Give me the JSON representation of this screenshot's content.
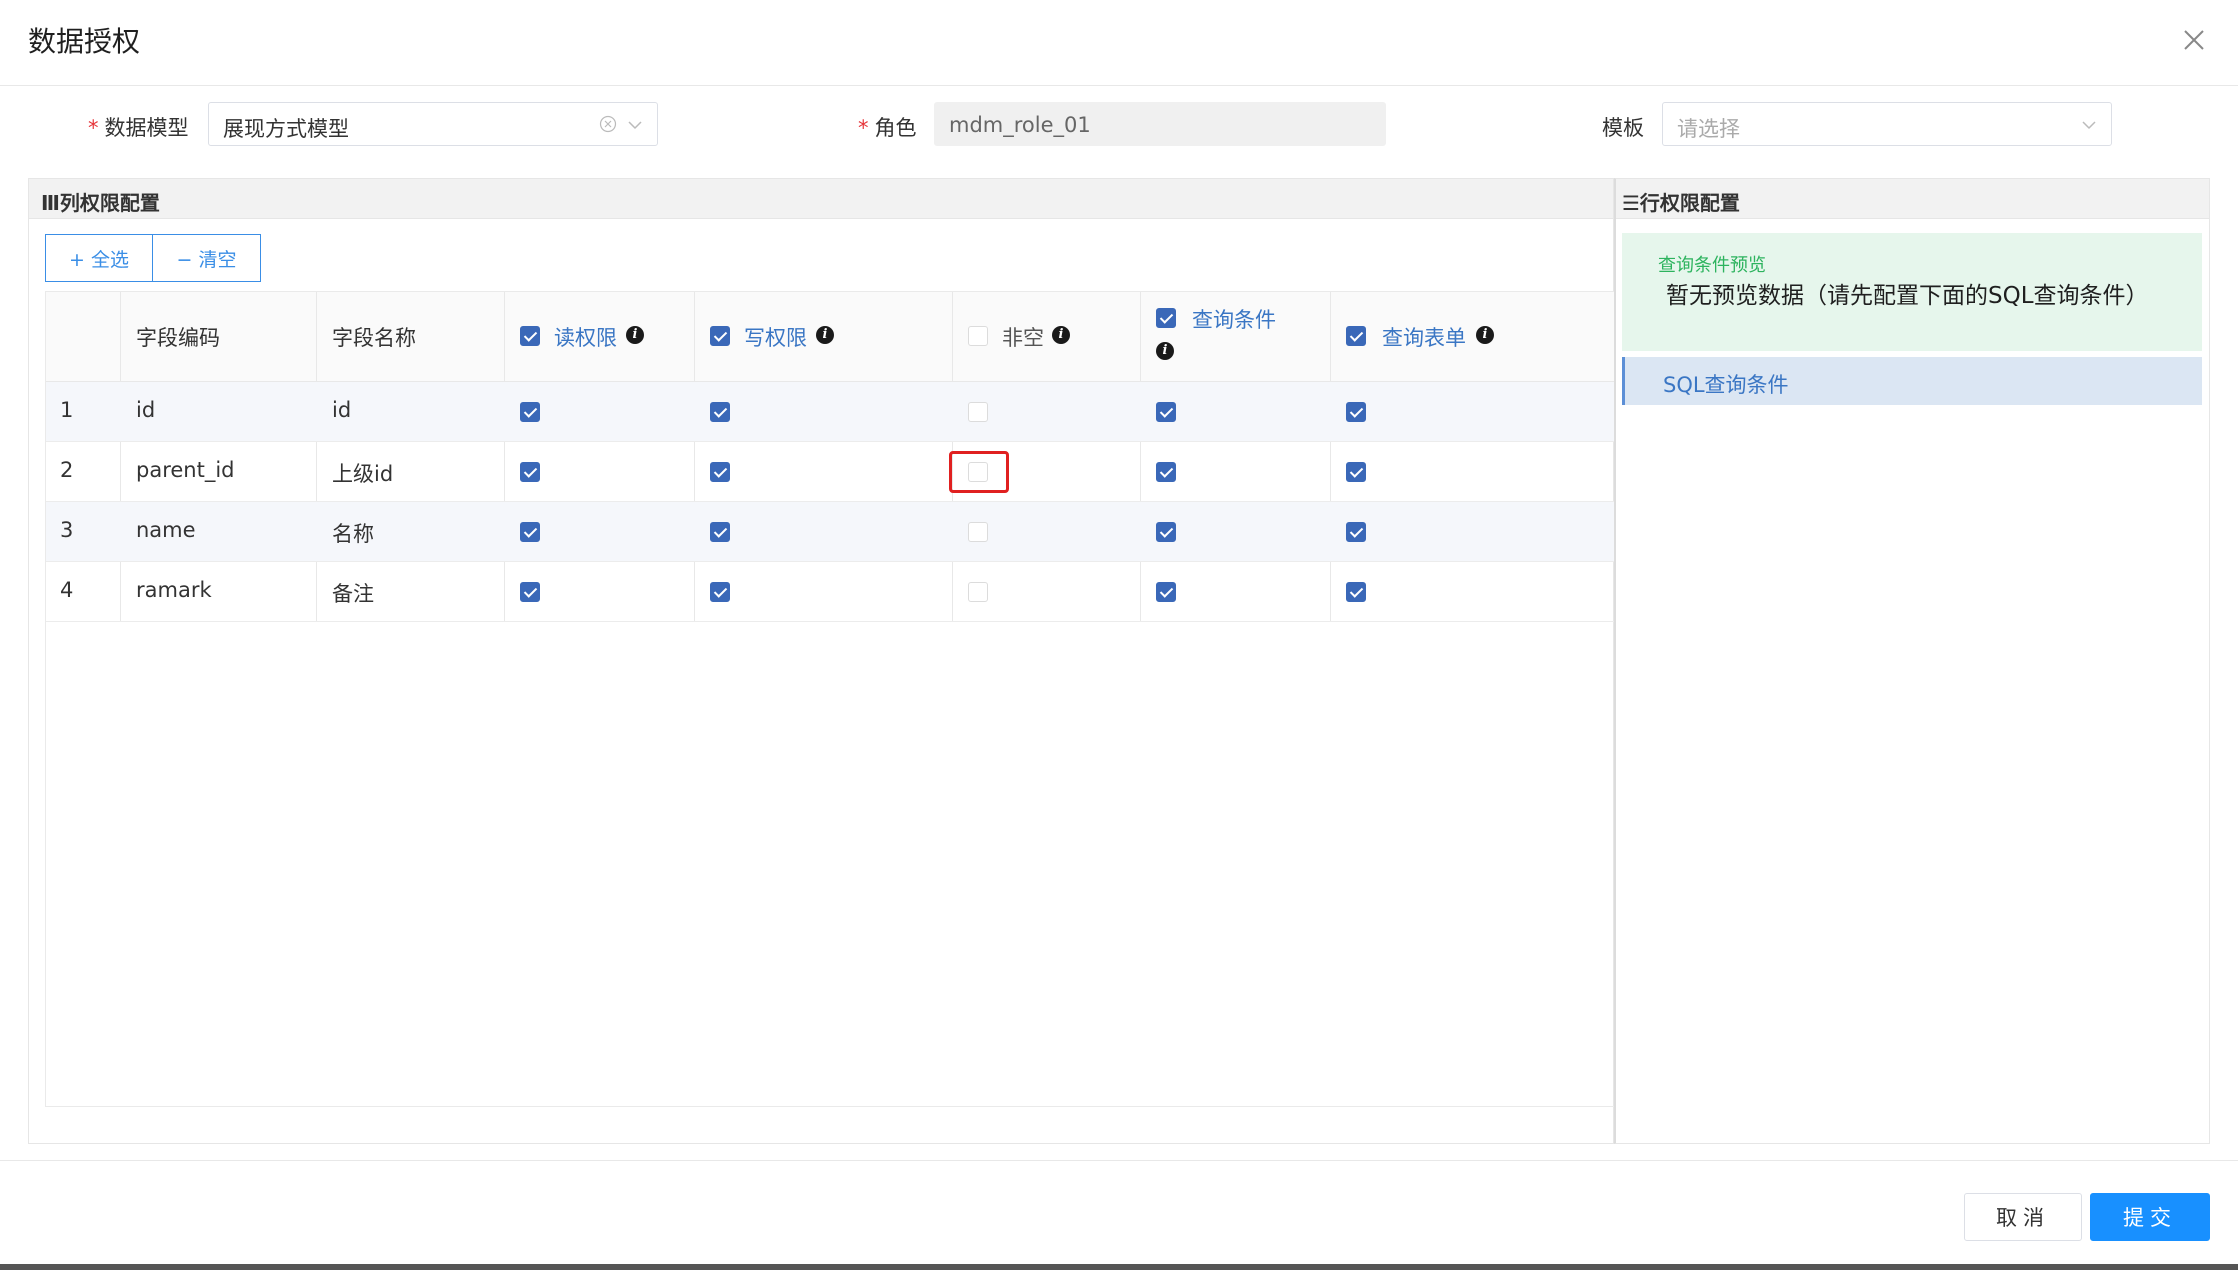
{
  "dialog": {
    "title": "数据授权"
  },
  "form": {
    "model_label": "数据模型",
    "model_value": "展现方式模型",
    "role_label": "角色",
    "role_value": "mdm_role_01",
    "template_label": "模板",
    "template_placeholder": "请选择"
  },
  "column_panel": {
    "title": "Ⅲ列权限配置",
    "select_all": "+ 全选",
    "clear": "− 清空",
    "headers": {
      "code": "字段编码",
      "name": "字段名称",
      "read": "读权限",
      "write": "写权限",
      "not_null": "非空",
      "query_cond": "查询条件",
      "query_form": "查询表单"
    },
    "header_checks": {
      "read": true,
      "write": true,
      "not_null": false,
      "query_cond": true,
      "query_form": true
    },
    "rows": [
      {
        "index": "1",
        "code": "id",
        "name": "id",
        "read": true,
        "write": true,
        "not_null": false,
        "query_cond": true,
        "query_form": true
      },
      {
        "index": "2",
        "code": "parent_id",
        "name": "上级id",
        "read": true,
        "write": true,
        "not_null": false,
        "query_cond": true,
        "query_form": true
      },
      {
        "index": "3",
        "code": "name",
        "name": "名称",
        "read": true,
        "write": true,
        "not_null": false,
        "query_cond": true,
        "query_form": true
      },
      {
        "index": "4",
        "code": "ramark",
        "name": "备注",
        "read": true,
        "write": true,
        "not_null": false,
        "query_cond": true,
        "query_form": true
      }
    ]
  },
  "row_panel": {
    "title": "☰行权限配置",
    "preview_label": "查询条件预览",
    "preview_text": "暂无预览数据（请先配置下面的SQL查询条件）",
    "sql_item": "SQL查询条件"
  },
  "footer": {
    "cancel": "取消",
    "submit": "提交"
  },
  "colors": {
    "primary": "#1890ff",
    "checkbox": "#3a68b8",
    "highlight": "#e02020",
    "preview_bg": "#e6f6ec"
  }
}
